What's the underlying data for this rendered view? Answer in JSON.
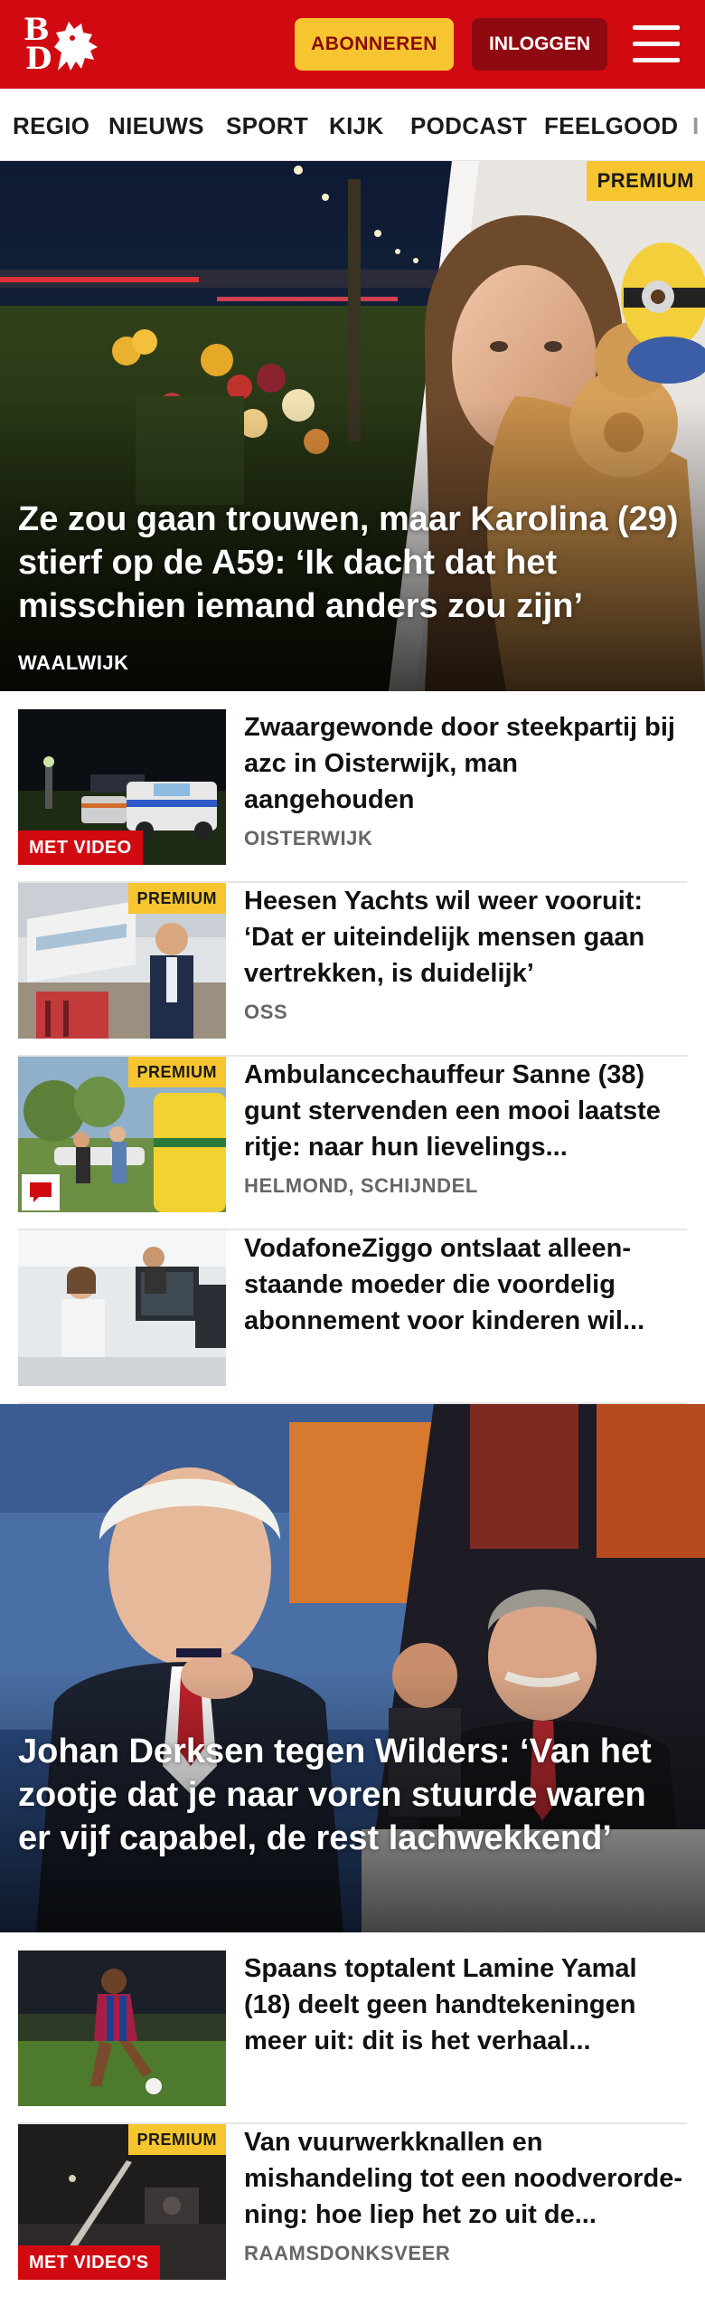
{
  "header": {
    "logo_letter_1": "B",
    "logo_letter_2": "D",
    "subscribe_label": "ABONNEREN",
    "login_label": "INLOGGEN"
  },
  "nav": {
    "items": [
      "REGIO",
      "NIEUWS",
      "SPORT",
      "KIJK",
      "PODCAST",
      "FEELGOOD",
      "I"
    ]
  },
  "hero": {
    "badge": "PREMIUM",
    "title": "Ze zou gaan trouwen, maar Karolina (29) stierf op de A59: ‘Ik dacht dat het misschien iemand anders zou zijn’",
    "location": "WAALWIJK"
  },
  "articles_1": [
    {
      "title": "Zwaargewonde door steekpartij bij azc in Oisterwijk, man aangehouden",
      "location": "OISTERWIJK",
      "badge": "MET VIDEO"
    },
    {
      "title": "Heesen Yachts wil weer vooruit: ‘Dat er uiteindelijk mensen gaan vertrekken, is duidelijk’",
      "location": "OSS",
      "badge": "PREMIUM"
    },
    {
      "title": "Ambulancechauffeur Sanne (38) gunt stervenden een mooi laatste ritje: naar hun lievelings...",
      "location": "HELMOND, SCHIJNDEL",
      "badge": "PREMIUM",
      "icon": "comment-icon"
    },
    {
      "title": "VodafoneZiggo ontslaat alleen­staande moeder die voordelig abonnement voor kinderen wil..."
    }
  ],
  "hero2": {
    "title": "Johan Derksen tegen Wilders: ‘Van het zootje dat je naar voren stuurde waren er vijf capabel, de rest lachwek­kend’"
  },
  "articles_2": [
    {
      "title": "Spaans toptalent Lamine Yamal (18) deelt geen handtekeningen meer uit: dit is het verhaal..."
    },
    {
      "title": "Van vuurwerkknallen en mishandeling tot een noodverorde­ning: hoe liep het zo uit de...",
      "location": "RAAMSDONKSVEER",
      "badge_top": "PREMIUM",
      "badge_bottom": "MET VIDEO'S"
    }
  ],
  "colors": {
    "brand_red": "#d10a11",
    "dark_red": "#8f0a10",
    "premium_yellow": "#f7c52f"
  }
}
